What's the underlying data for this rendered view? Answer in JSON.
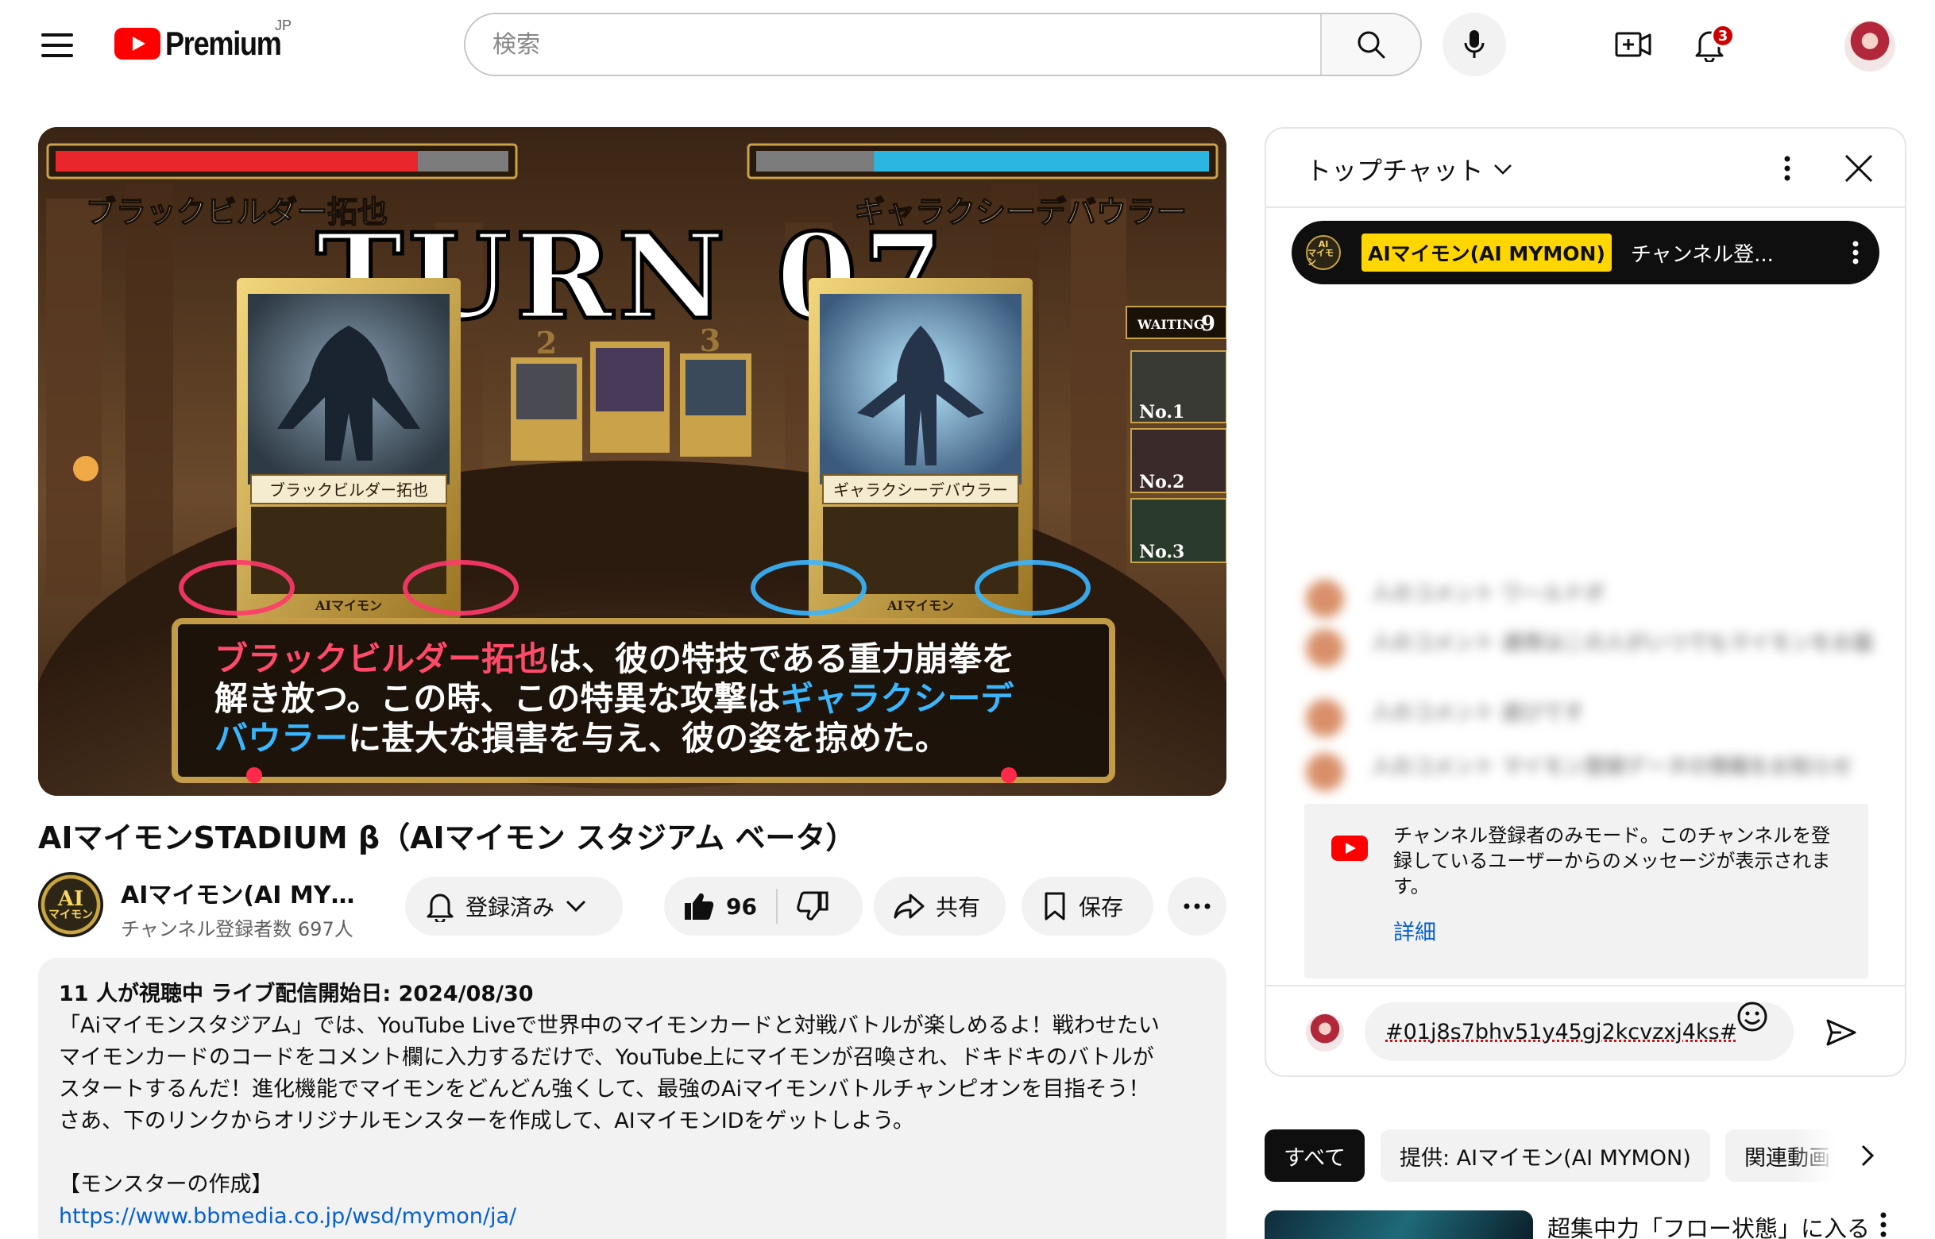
{
  "header": {
    "logo_text": "Premium",
    "region": "JP",
    "search_placeholder": "検索",
    "notification_count": "3"
  },
  "video": {
    "title": "AIマイモンSTADIUM β（AIマイモン スタジアム ベータ）",
    "overlay": {
      "turn_text": "TURN 07",
      "left_player": "ブラックビルダー拓也",
      "right_player": "ギャラクシーデバウラー",
      "left_card_name": "ブラックビルダー拓也",
      "right_card_name": "ギャラクシーデバウラー",
      "waiting_label": "WAITING",
      "waiting_count": "9",
      "queue": [
        "No.1",
        "No.2",
        "No.3"
      ],
      "mini_cards": [
        "2",
        "3"
      ],
      "card_brand": "AIマイモン",
      "left_hp_fraction": 0.8,
      "right_hp_fraction": 0.74,
      "narration": {
        "l1_a": "ブラックビルダー拓也",
        "l1_b": "は、彼の特技である重力崩拳を",
        "l2_a": "解き放つ。この時、この特異な攻撃は",
        "l2_b": "ギャラクシーデ",
        "l3_a": "バウラー",
        "l3_b": "に甚大な損害を与え、彼の姿を掠めた。"
      }
    }
  },
  "channel": {
    "name": "AIマイモン(AI MYMON)",
    "subscribers": "チャンネル登録者数 697人",
    "avatar_text_top": "AI",
    "avatar_text_bottom": "マイモン"
  },
  "actions": {
    "subscribed_label": "登録済み",
    "like_count": "96",
    "share_label": "共有",
    "save_label": "保存"
  },
  "description": {
    "meta": "11 人が視聴中  ライブ配信開始日: 2024/08/30",
    "lines": [
      "「Aiマイモンスタジアム」では、YouTube Liveで世界中のマイモンカードと対戦バトルが楽しめるよ！戦わせたい",
      "マイモンカードのコードをコメント欄に入力するだけで、YouTube上にマイモンが召喚され、ドキドキのバトルが",
      "スタートするんだ！進化機能でマイモンをどんどん強くして、最強のAiマイモンバトルチャンピオンを目指そう！",
      "さあ、下のリンクからオリジナルモンスターを作成して、AIマイモンIDをゲットしよう。"
    ],
    "section_heading": "【モンスターの作成】",
    "link": "https://www.bbmedia.co.jp/wsd/mymon/ja/"
  },
  "chat": {
    "mode_label": "トップチャット",
    "ticker_author": "AIマイモン(AI MYMON)",
    "ticker_text": "チャンネル登...",
    "blurred_messages": [
      "人のコメント  ワールドボ",
      "人のコメント  通常はこの人がいつでもマイモンをお届",
      "人のコメント  遊びです",
      "人のコメント  マイモン登録データの情報をお知らせ"
    ],
    "notice_text": "チャンネル登録者のみモード。このチャンネルを登録しているユーザーからのメッセージが表示されます。",
    "notice_link": "詳細",
    "input_value": "#01j8s7bhv51y45gj2kcvzxj4ks#"
  },
  "chips": {
    "all": "すべて",
    "provider": "提供: AIマイモン(AI MYMON)",
    "related": "関連動画"
  },
  "related": {
    "title": "超集中力「フロー状態」に入る"
  },
  "colors": {
    "brand_red": "#ff0000",
    "link_blue": "#065fd4",
    "ticker_yellow": "#ffd600",
    "left_hp": "#e8262c",
    "right_hp": "#2ab6e0"
  }
}
